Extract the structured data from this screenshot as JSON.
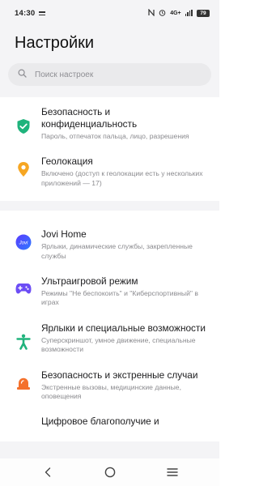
{
  "status": {
    "time": "14:30",
    "network": "4G+",
    "battery": "79"
  },
  "header": {
    "title": "Настройки"
  },
  "search": {
    "placeholder": "Поиск настроек"
  },
  "items": [
    {
      "title": "Безопасность и конфиденциальность",
      "subtitle": "Пароль, отпечаток пальца, лицо, разрешения",
      "icon": "shield-check-icon",
      "color": "#1fb37c"
    },
    {
      "title": "Геолокация",
      "subtitle": "Включено (доступ к геолокации есть у нескольких приложений — 17)",
      "icon": "location-pin-icon",
      "color": "#f6a623"
    },
    {
      "title": "Jovi Home",
      "subtitle": "Ярлыки, динамические службы, закрепленные службы",
      "icon": "jovi-icon",
      "color": "#3b5bfd"
    },
    {
      "title": "Ультраигровой режим",
      "subtitle": "Режимы \"Не беспокоить\" и \"Киберспортивный\" в играх",
      "icon": "gamepad-icon",
      "color": "#6c4df5"
    },
    {
      "title": "Ярлыки и специальные возможности",
      "subtitle": "Суперскриншот, умное движение, специальные возможности",
      "icon": "accessibility-icon",
      "color": "#1fb37c"
    },
    {
      "title": "Безопасность и экстренные случаи",
      "subtitle": "Экстренные вызовы, медицинские данные, оповещения",
      "icon": "emergency-siren-icon",
      "color": "#f4702b"
    },
    {
      "title": "Цифровое благополучие и",
      "subtitle": "",
      "icon": "",
      "color": ""
    }
  ]
}
